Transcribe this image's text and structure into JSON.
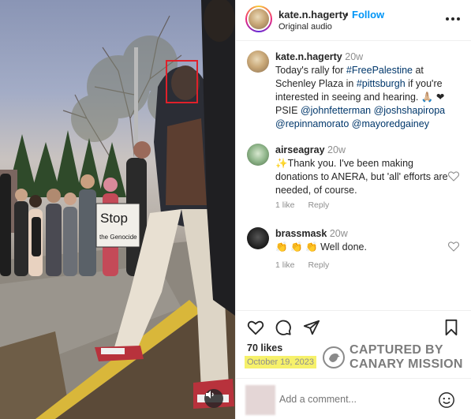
{
  "post": {
    "username": "kate.n.hagerty",
    "separator": "•",
    "follow_label": "Follow",
    "subtitle": "Original audio",
    "more_icon": "more-horizontal-icon"
  },
  "photo": {
    "sign_line1": "Stop",
    "sign_line2": "the Genocide",
    "sound_icon": "speaker-icon",
    "highlight_color": "#e0202a"
  },
  "comments": [
    {
      "username": "kate.n.hagerty",
      "time": "20w",
      "text_parts": [
        {
          "t": "Today's rally for ",
          "tag": false
        },
        {
          "t": "#FreePalestine",
          "tag": true
        },
        {
          "t": " at Schenley Plaza in ",
          "tag": false
        },
        {
          "t": "#pittsburgh",
          "tag": true
        },
        {
          "t": " if you're interested in seeing and hearing. 🙏🏼 ❤PSIE ",
          "tag": false
        },
        {
          "t": "@johnfetterman",
          "tag": true
        },
        {
          "t": " ",
          "tag": false
        },
        {
          "t": "@joshshapiropa",
          "tag": true
        },
        {
          "t": " ",
          "tag": false
        },
        {
          "t": "@repinnamorato",
          "tag": true
        },
        {
          "t": " ",
          "tag": false
        },
        {
          "t": "@mayoredgainey",
          "tag": true
        }
      ]
    },
    {
      "username": "airseagray",
      "time": "20w",
      "text": "✨Thank you. I've been making donations to ANERA, but 'all' efforts are needed, of course.",
      "likes": "1 like",
      "reply": "Reply"
    },
    {
      "username": "brassmask",
      "time": "20w",
      "text": "👏 👏 👏  Well done.",
      "likes": "1 like",
      "reply": "Reply"
    }
  ],
  "actions": {
    "like_icon": "heart-icon",
    "comment_icon": "comment-icon",
    "share_icon": "send-icon",
    "save_icon": "bookmark-icon",
    "likes_count": "70 likes",
    "date": "October 19, 2023"
  },
  "watermark": {
    "line1": "CAPTURED BY",
    "line2": "CANARY MISSION"
  },
  "comment_box": {
    "placeholder": "Add a comment...",
    "emoji_icon": "smiley-icon"
  },
  "colors": {
    "follow_blue": "#0095f6",
    "tag_blue": "#00376b",
    "date_highlight": "#f6f16a",
    "muted": "#8e8e8e"
  }
}
